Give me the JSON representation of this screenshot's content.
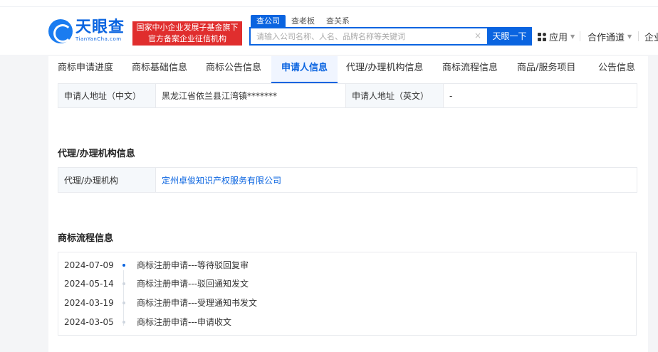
{
  "header": {
    "logo_cn": "天眼查",
    "logo_en": "TianYanCha.com",
    "banner_line1": "国家中小企业发展子基金旗下",
    "banner_line2": "官方备案企业征信机构",
    "search_tabs": [
      "查公司",
      "查老板",
      "查关系"
    ],
    "search_placeholder": "请输入公司名称、人名、品牌名称等关键词",
    "search_button": "天眼一下",
    "nav_apps": "应用",
    "nav_coop": "合作通道",
    "nav_enterprise": "企业"
  },
  "tabs": [
    "商标申请进度",
    "商标基础信息",
    "商标公告信息",
    "申请人信息",
    "代理/办理机构信息",
    "商标流程信息",
    "商品/服务项目",
    "公告信息"
  ],
  "applicant": {
    "addr_cn_label": "申请人地址（中文）",
    "addr_cn_value": "黑龙江省依兰县江湾镇*******",
    "addr_en_label": "申请人地址（英文）",
    "addr_en_value": "-"
  },
  "agency": {
    "title": "代理/办理机构信息",
    "label": "代理/办理机构",
    "value": "定州卓俊知识产权服务有限公司"
  },
  "flow": {
    "title": "商标流程信息",
    "items": [
      {
        "date": "2024-07-09",
        "text": "商标注册申请---等待驳回复审"
      },
      {
        "date": "2024-05-14",
        "text": "商标注册申请---驳回通知发文"
      },
      {
        "date": "2024-03-19",
        "text": "商标注册申请---受理通知书发文"
      },
      {
        "date": "2024-03-05",
        "text": "商标注册申请---申请收文"
      }
    ]
  }
}
